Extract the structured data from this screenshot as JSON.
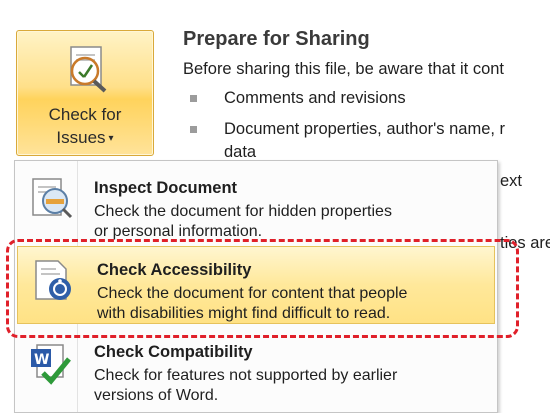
{
  "check_issues": {
    "line1": "Check for",
    "line2": "Issues",
    "caret": "▾",
    "icon": "check-issues-icon"
  },
  "share_pane": {
    "title": "Prepare for Sharing",
    "description": "Before sharing this file, be aware that it cont",
    "items": [
      "Comments and revisions",
      "Document properties, author's name, r",
      "data"
    ],
    "fragments": [
      "ext",
      "ties are"
    ]
  },
  "menu": {
    "items": [
      {
        "title": "Inspect Document",
        "desc1": "Check the document for hidden properties",
        "desc2": "or personal information.",
        "icon": "inspect-document-icon",
        "highlighted": false
      },
      {
        "title": "Check Accessibility",
        "desc1": "Check the document for content that people",
        "desc2": "with disabilities might find difficult to read.",
        "icon": "accessibility-check-icon",
        "highlighted": true
      },
      {
        "title": "Check Compatibility",
        "desc1": "Check for features not supported by earlier",
        "desc2": "versions of Word.",
        "icon": "word-compatibility-icon",
        "highlighted": false
      }
    ]
  },
  "colors": {
    "highlight": "#ffe285",
    "annotation": "#e0202a",
    "button_border": "#d9a93a"
  }
}
